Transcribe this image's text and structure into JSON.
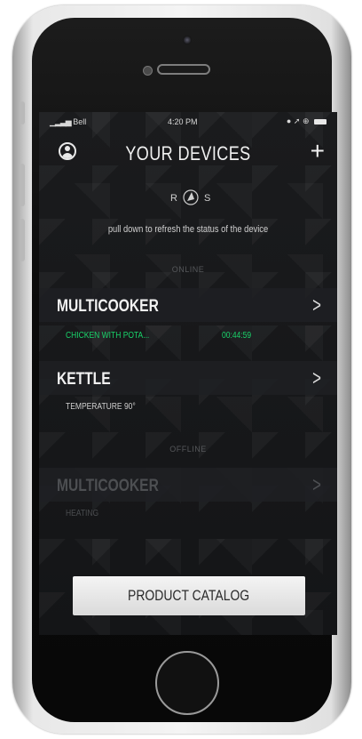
{
  "status_bar": {
    "carrier": "Bell",
    "time": "4:20 PM"
  },
  "header": {
    "title": "YOUR DEVICES",
    "profile_icon": "user-circle-icon",
    "add_icon": "plus-icon",
    "add_glyph": "+"
  },
  "logo": {
    "left": "R",
    "right": "S"
  },
  "hint": "pull down to refresh the status of the device",
  "sections": {
    "online_label": "ONLINE",
    "offline_label": "OFFLINE"
  },
  "devices": [
    {
      "name": "MULTICOOKER",
      "chevron": ">",
      "detail_left": "CHICKEN WITH POTA...",
      "detail_right": "00:44:59",
      "status": "online"
    },
    {
      "name": "KETTLE",
      "chevron": ">",
      "detail_left": "TEMPERATURE 90°",
      "status": "online"
    },
    {
      "name": "MULTICOOKER",
      "chevron": ">",
      "detail_left": "HEATING",
      "status": "offline"
    }
  ],
  "catalog_button": "PRODUCT CATALOG",
  "colors": {
    "accent_green": "#19d36a",
    "screen_bg": "#161719",
    "button_bg": "#ececec"
  }
}
